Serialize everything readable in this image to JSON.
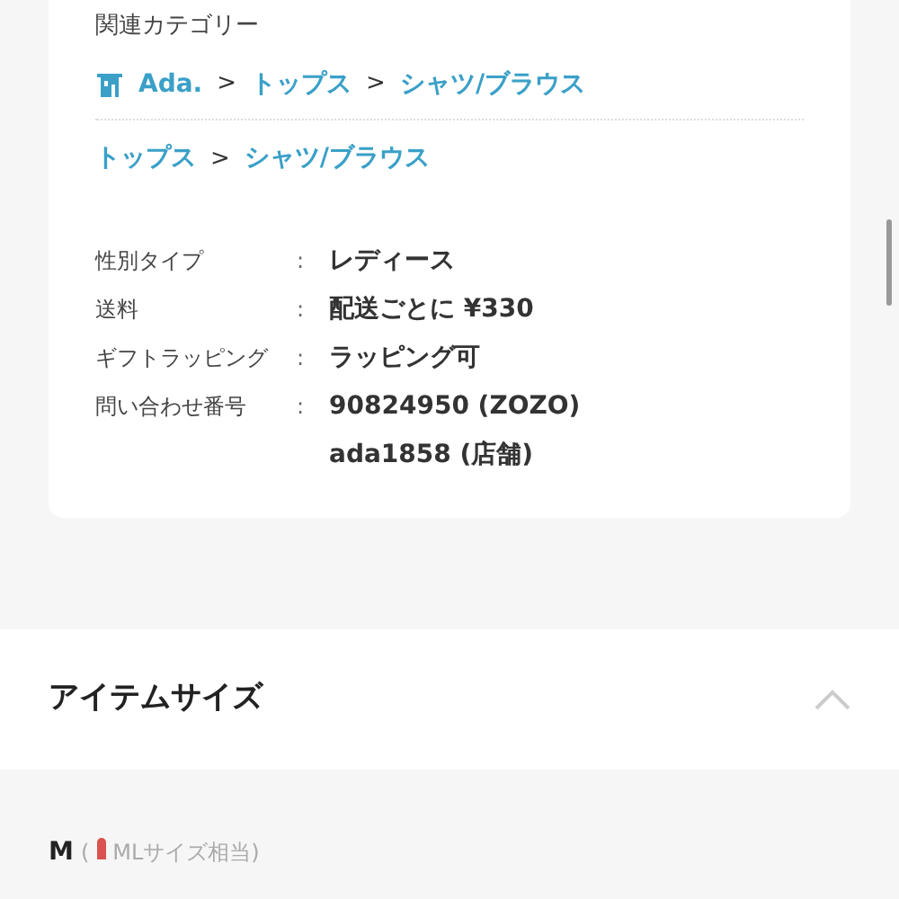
{
  "related_categories": {
    "title": "関連カテゴリー",
    "breadcrumbs": [
      {
        "kind": "shop",
        "items": [
          "Ada.",
          "トップス",
          "シャツ/ブラウス"
        ],
        "separator": ">"
      },
      {
        "kind": "plain",
        "items": [
          "トップス",
          "シャツ/ブラウス"
        ],
        "separator": ">"
      }
    ]
  },
  "details": [
    {
      "label": "性別タイプ",
      "separator": ":",
      "values": [
        "レディース"
      ]
    },
    {
      "label": "送料",
      "separator": ":",
      "values": [
        "配送ごとに ¥330"
      ]
    },
    {
      "label": "ギフトラッピング",
      "separator": ":",
      "values": [
        "ラッピング可"
      ]
    },
    {
      "label": "問い合わせ番号",
      "separator": ":",
      "values": [
        "90824950 (ZOZO)",
        "ada1858 (店舗)"
      ]
    }
  ],
  "item_size": {
    "title": "アイテムサイズ",
    "expanded": true,
    "size": "M",
    "note_open": "(",
    "note": "MLサイズ相当)"
  }
}
